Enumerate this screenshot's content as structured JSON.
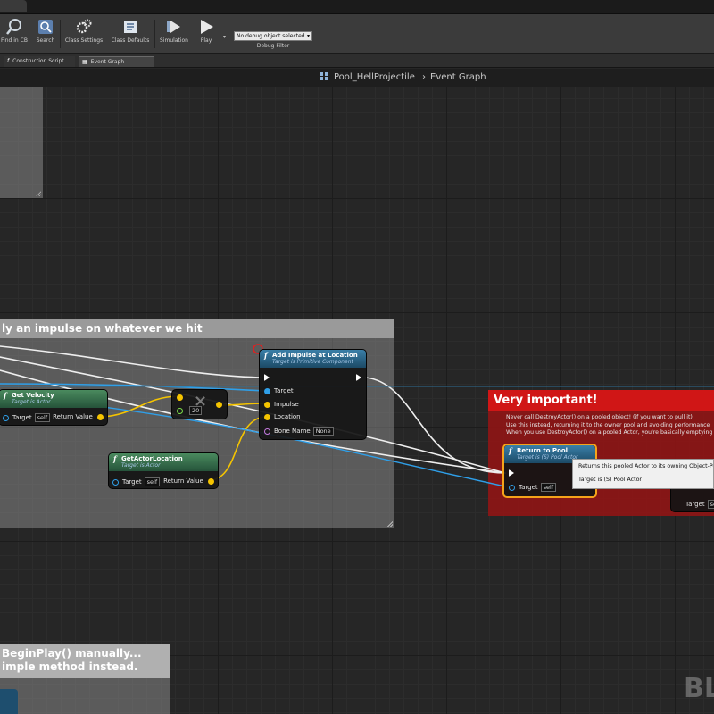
{
  "toolbar": {
    "buttons": [
      {
        "label": "Find in CB",
        "icon": "binoculars-icon"
      },
      {
        "label": "Search",
        "icon": "search-icon"
      },
      {
        "label": "Class Settings",
        "icon": "gears-icon"
      },
      {
        "label": "Class Defaults",
        "icon": "checklist-icon"
      },
      {
        "label": "Simulation",
        "icon": "simulation-icon"
      },
      {
        "label": "Play",
        "icon": "play-icon"
      }
    ],
    "debug_select_value": "No debug object selected",
    "debug_filter_label": "Debug Filter"
  },
  "doc_tabs": [
    {
      "label": "Construction Script",
      "icon": "function-icon"
    },
    {
      "label": "Event Graph",
      "icon": "grid-icon"
    }
  ],
  "breadcrumb": {
    "blueprint": "Pool_HellProjectile",
    "graph": "Event Graph",
    "separator": "›"
  },
  "comments": {
    "impulse_title": "ly an impulse on whatever we hit",
    "begin_play_line1": "BeginPlay() manually...",
    "begin_play_line2": "imple method instead.",
    "important_title": "Very important!",
    "important_lines": [
      "Never call DestroyActor() on a pooled object!  (if you want to pull it)",
      "Use this instead, returning it to the owner pool and avoiding performance",
      "When you use DestroyActor() on a pooled Actor, you're basically emptying"
    ]
  },
  "nodes": {
    "get_velocity": {
      "title": "Get Velocity",
      "subtitle": "Target is Actor",
      "target_label": "Target",
      "target_value": "self",
      "return_label": "Return Value"
    },
    "multiply": {
      "symbol": "×",
      "value": "20"
    },
    "add_impulse": {
      "title": "Add Impulse at Location",
      "subtitle": "Target is Primitive Component",
      "pins": [
        "Target",
        "Impulse",
        "Location"
      ],
      "bone_label": "Bone Name",
      "bone_value": "None"
    },
    "get_actor_location": {
      "title": "GetActorLocation",
      "subtitle": "Target is Actor",
      "target_label": "Target",
      "target_value": "self",
      "return_label": "Return Value"
    },
    "return_to_pool": {
      "title": "Return to Pool",
      "subtitle": "Target is (S) Pool Actor",
      "target_label": "Target",
      "target_value": "self"
    },
    "offscreen_node": {
      "target_label": "Target",
      "target_value": "se"
    }
  },
  "tooltip": {
    "line1": "Returns this pooled Actor to its owning Object-Pool",
    "line2": "Target is (S) Pool Actor"
  },
  "watermark": "BL",
  "colors": {
    "exec": "#ffffff",
    "object": "#2f9fe8",
    "vector": "#f5c400",
    "name": "#c77ae0",
    "float": "#7ee04b",
    "important": "#d01616",
    "selection": "#f5a31a"
  }
}
